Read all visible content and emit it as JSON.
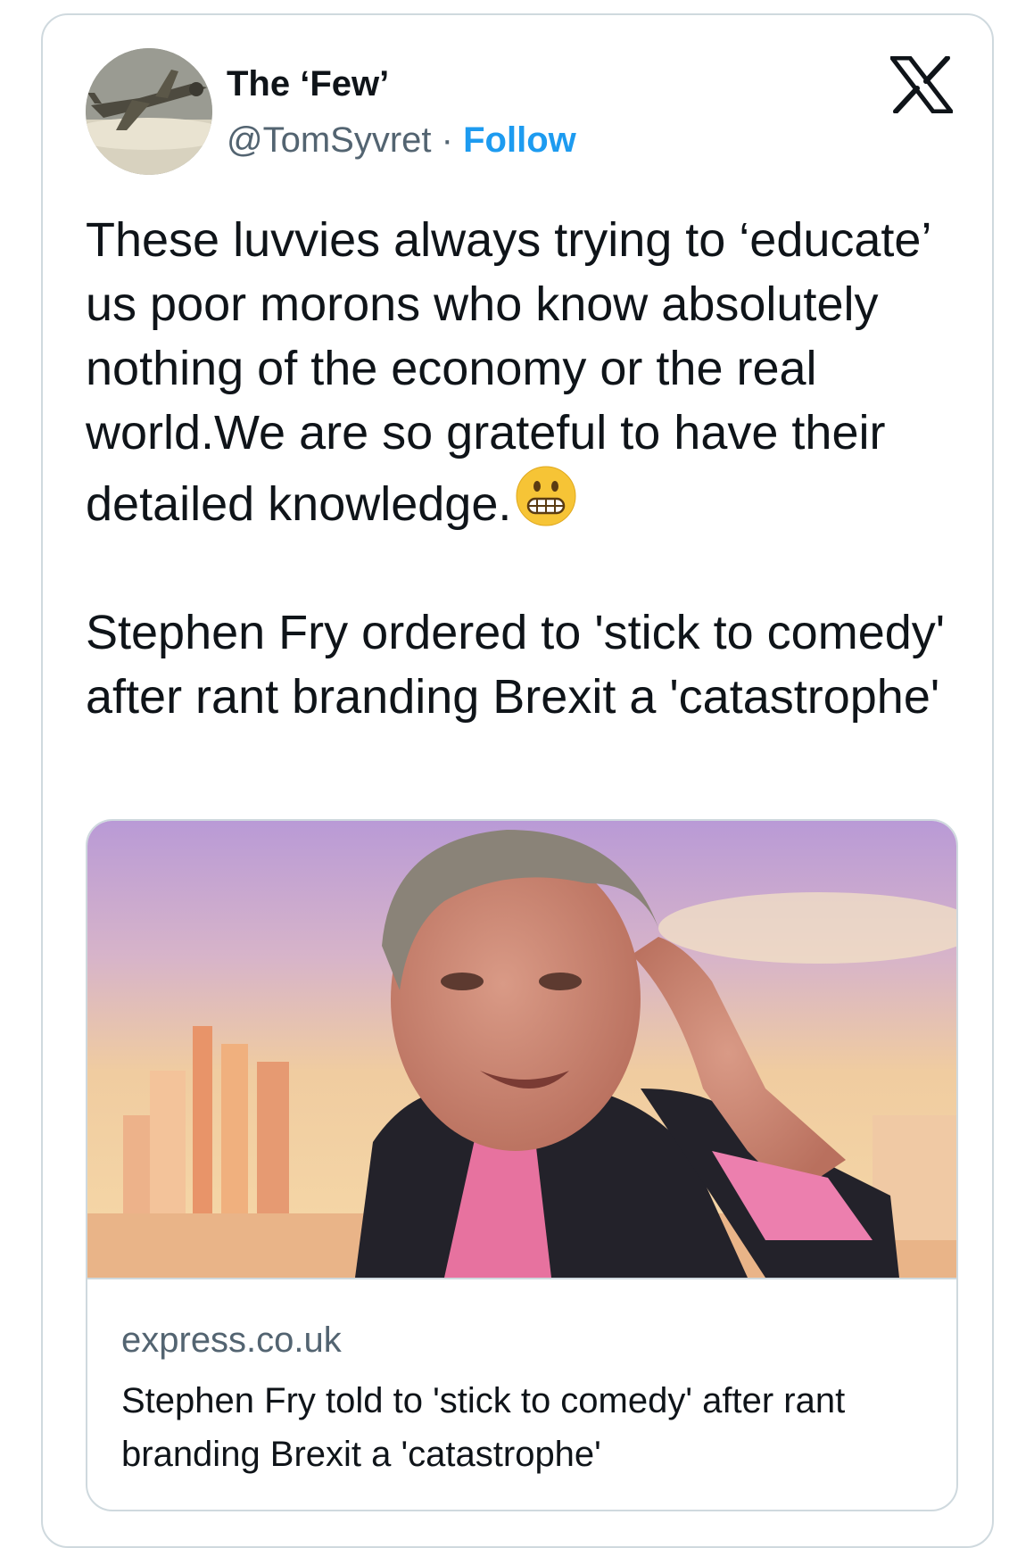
{
  "author": {
    "display_name": "The ‘Few’",
    "handle": "@TomSyvret",
    "separator": "·",
    "follow_label": "Follow",
    "avatar_icon": "spitfire-plane-avatar"
  },
  "platform_icon": "x-logo-icon",
  "tweet": {
    "paragraph_1": "These luvvies always trying to ‘educate’ us poor morons who know absolutely nothing of the economy or the real world.We are so grateful to have their detailed knowledge.",
    "emoji": "grimacing-face-emoji",
    "paragraph_2": "Stephen Fry ordered to 'stick to comedy' after rant branding Brexit a 'catastrophe'"
  },
  "link_card": {
    "domain": "express.co.uk",
    "title": "Stephen Fry told to 'stick to comedy' after rant branding Brexit a 'catastrophe'",
    "image_subject": "man-in-dark-jacket-and-pink-shirt-photo"
  },
  "colors": {
    "follow_blue": "#1d9bf0",
    "secondary_text": "#536471",
    "border": "#cfd9de",
    "text": "#0f1419"
  }
}
